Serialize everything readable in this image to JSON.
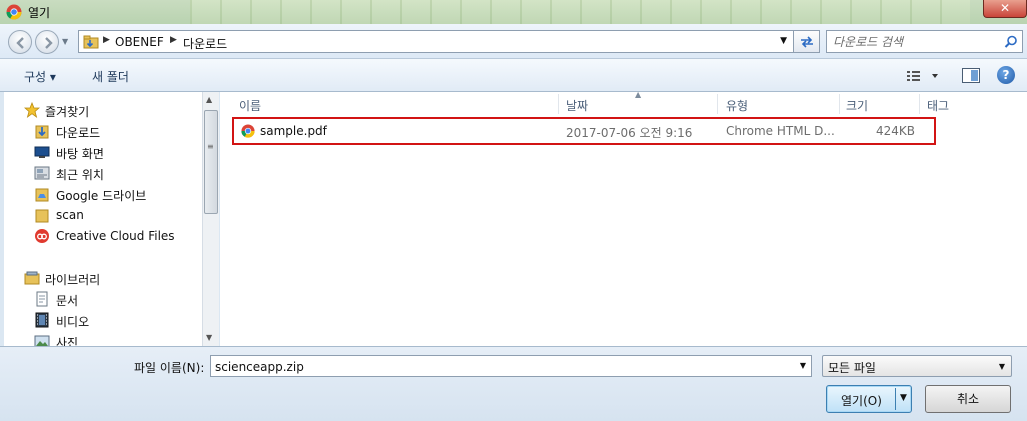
{
  "window": {
    "title": "열기",
    "close_label": "✕"
  },
  "address": {
    "crumbs": [
      "OBENEF",
      "다운로드"
    ],
    "search_placeholder": "다운로드 검색"
  },
  "toolbar": {
    "organize_label": "구성 ▾",
    "new_folder_label": "새 폴더"
  },
  "sidebar": {
    "favorites_label": "즐겨찾기",
    "favorites": [
      {
        "label": "다운로드",
        "icon": "downloads-folder-icon"
      },
      {
        "label": "바탕 화면",
        "icon": "desktop-icon"
      },
      {
        "label": "최근 위치",
        "icon": "recent-places-icon"
      },
      {
        "label": "Google 드라이브",
        "icon": "folder-icon"
      },
      {
        "label": "scan",
        "icon": "folder-icon"
      },
      {
        "label": "Creative Cloud Files",
        "icon": "creative-cloud-icon"
      }
    ],
    "libraries_label": "라이브러리",
    "libraries": [
      {
        "label": "문서",
        "icon": "documents-icon"
      },
      {
        "label": "비디오",
        "icon": "video-icon"
      },
      {
        "label": "사진",
        "icon": "pictures-icon"
      }
    ]
  },
  "columns": {
    "name": "이름",
    "date": "날짜",
    "type": "유형",
    "size": "크기",
    "tags": "태그"
  },
  "files": [
    {
      "name": "sample.pdf",
      "date": "2017-07-06 오전 9:16",
      "type": "Chrome HTML D...",
      "size": "424KB"
    }
  ],
  "footer": {
    "filename_label": "파일 이름(N):",
    "filename_value": "scienceapp.zip",
    "filetype_value": "모든 파일",
    "open_label": "열기(O)",
    "cancel_label": "취소"
  },
  "colors": {
    "highlight_border": "#d21414",
    "accent": "#3c7fb1"
  }
}
